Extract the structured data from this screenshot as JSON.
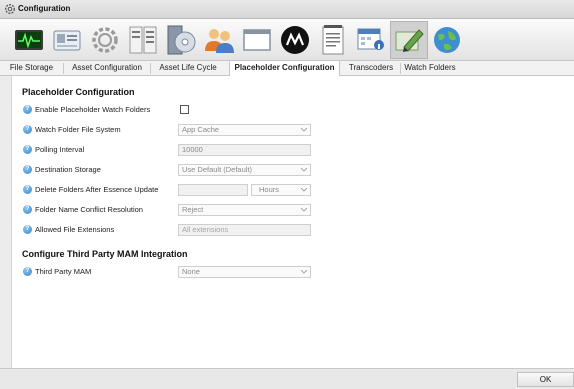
{
  "window": {
    "title": "Configuration"
  },
  "toolbar": {
    "tools": [
      {
        "icon": "monitor-waveform-icon"
      },
      {
        "icon": "id-card-icon"
      },
      {
        "icon": "gear-icon"
      },
      {
        "icon": "server-rack-icon"
      },
      {
        "icon": "disc-drive-icon"
      },
      {
        "icon": "users-icon"
      },
      {
        "icon": "window-icon"
      },
      {
        "icon": "brand-logo-icon"
      },
      {
        "icon": "notepad-icon"
      },
      {
        "icon": "calendar-user-icon"
      },
      {
        "icon": "pencil-edit-icon",
        "selected": true
      },
      {
        "icon": "globe-icon"
      }
    ]
  },
  "tabs": [
    {
      "label": "File Storage"
    },
    {
      "label": "Asset Configuration"
    },
    {
      "label": "Asset Life Cycle"
    },
    {
      "label": "Placeholder Configuration",
      "active": true
    },
    {
      "label": "Transcoders"
    },
    {
      "label": "Watch Folders"
    }
  ],
  "placeholder": {
    "heading": "Placeholder Configuration",
    "enable_label": "Enable Placeholder Watch Folders",
    "enable_checked": false,
    "watch_fs_label": "Watch Folder File System",
    "watch_fs_value": "App Cache",
    "polling_label": "Polling Interval",
    "polling_value": "10000",
    "dest_label": "Destination Storage",
    "dest_value": "Use Default (Default)",
    "delete_label": "Delete Folders After Essence Update",
    "delete_value": "",
    "delete_unit": "Hours",
    "conflict_label": "Folder Name Conflict Resolution",
    "conflict_value": "Reject",
    "ext_label": "Allowed File Extensions",
    "ext_value": "All extensions"
  },
  "mam": {
    "heading": "Configure Third Party MAM Integration",
    "label": "Third Party MAM",
    "value": "None"
  },
  "footer": {
    "ok_label": "OK"
  },
  "colors": {
    "help_icon": "#3a86c8",
    "panel_bg": "#ffffff",
    "chrome_bg": "#ececec"
  }
}
